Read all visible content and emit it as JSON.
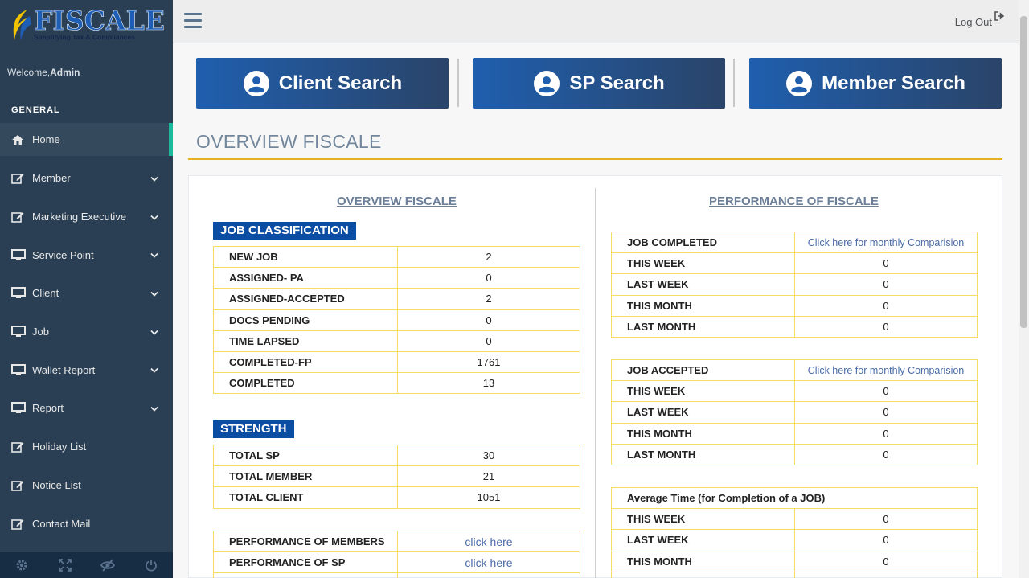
{
  "brand": {
    "name": "FISCALE",
    "tagline": "Simplifying Tax & Compliances"
  },
  "welcome": {
    "prefix": "Welcome,",
    "user": "Admin"
  },
  "sidebar": {
    "section": "GENERAL",
    "items": [
      {
        "label": "Home",
        "icon": "home-icon",
        "active": true
      },
      {
        "label": "Member",
        "icon": "edit-icon"
      },
      {
        "label": "Marketing Executive",
        "icon": "edit-icon"
      },
      {
        "label": "Service Point",
        "icon": "monitor-icon"
      },
      {
        "label": "Client",
        "icon": "monitor-icon"
      },
      {
        "label": "Job",
        "icon": "monitor-icon"
      },
      {
        "label": "Wallet Report",
        "icon": "monitor-icon"
      },
      {
        "label": "Report",
        "icon": "monitor-icon"
      },
      {
        "label": "Holiday List",
        "icon": "edit-icon"
      },
      {
        "label": "Notice List",
        "icon": "edit-icon"
      },
      {
        "label": "Contact Mail",
        "icon": "edit-icon"
      }
    ],
    "footer_icons": [
      "settings-icon",
      "fullscreen-icon",
      "eye-slash-icon",
      "power-icon"
    ]
  },
  "topbar": {
    "logout": "Log Out"
  },
  "search_buttons": {
    "client": "Client Search",
    "sp": "SP Search",
    "member": "Member Search"
  },
  "page_title": "OVERVIEW FISCALE",
  "left": {
    "heading": "OVERVIEW FISCALE",
    "job_classification": {
      "title": "JOB CLASSIFICATION",
      "rows": [
        {
          "label": "NEW JOB",
          "value": "2"
        },
        {
          "label": "ASSIGNED- PA",
          "value": "0"
        },
        {
          "label": "ASSIGNED-ACCEPTED",
          "value": "2"
        },
        {
          "label": "DOCS PENDING",
          "value": "0"
        },
        {
          "label": "TIME LAPSED",
          "value": "0"
        },
        {
          "label": "COMPLETED-FP",
          "value": "1761"
        },
        {
          "label": "COMPLETED",
          "value": "13"
        }
      ]
    },
    "strength": {
      "title": "STRENGTH",
      "rows": [
        {
          "label": "TOTAL SP",
          "value": "30"
        },
        {
          "label": "TOTAL MEMBER",
          "value": "21"
        },
        {
          "label": "TOTAL CLIENT",
          "value": "1051"
        }
      ]
    },
    "performance": {
      "rows": [
        {
          "label": "PERFORMANCE OF MEMBERS",
          "value": "click here"
        },
        {
          "label": "PERFORMANCE OF SP",
          "value": "click here"
        }
      ]
    }
  },
  "right": {
    "heading": "PERFORMANCE OF FISCALE",
    "job_completed": {
      "title": "JOB COMPLETED",
      "link": "Click here for monthly Comparision",
      "rows": [
        {
          "label": "THIS WEEK",
          "value": "0"
        },
        {
          "label": "LAST WEEK",
          "value": "0"
        },
        {
          "label": "THIS MONTH",
          "value": "0"
        },
        {
          "label": "LAST MONTH",
          "value": "0"
        }
      ]
    },
    "job_accepted": {
      "title": "JOB ACCEPTED",
      "link": "Click here for monthly Comparision",
      "rows": [
        {
          "label": "THIS WEEK",
          "value": "0"
        },
        {
          "label": "LAST WEEK",
          "value": "0"
        },
        {
          "label": "THIS MONTH",
          "value": "0"
        },
        {
          "label": "LAST MONTH",
          "value": "0"
        }
      ]
    },
    "average_time": {
      "title": "Average Time (for Completion of a JOB)",
      "rows": [
        {
          "label": "THIS WEEK",
          "value": "0"
        },
        {
          "label": "LAST WEEK",
          "value": "0"
        },
        {
          "label": "THIS MONTH",
          "value": "0"
        }
      ]
    }
  },
  "colors": {
    "sidebar_bg": "#2a3f54",
    "accent_active": "#1ABB9C",
    "button_blue": "#1f5fae",
    "title_rule": "#e6b020",
    "table_border": "#f3dd62",
    "tag_blue": "#0b4da2"
  }
}
